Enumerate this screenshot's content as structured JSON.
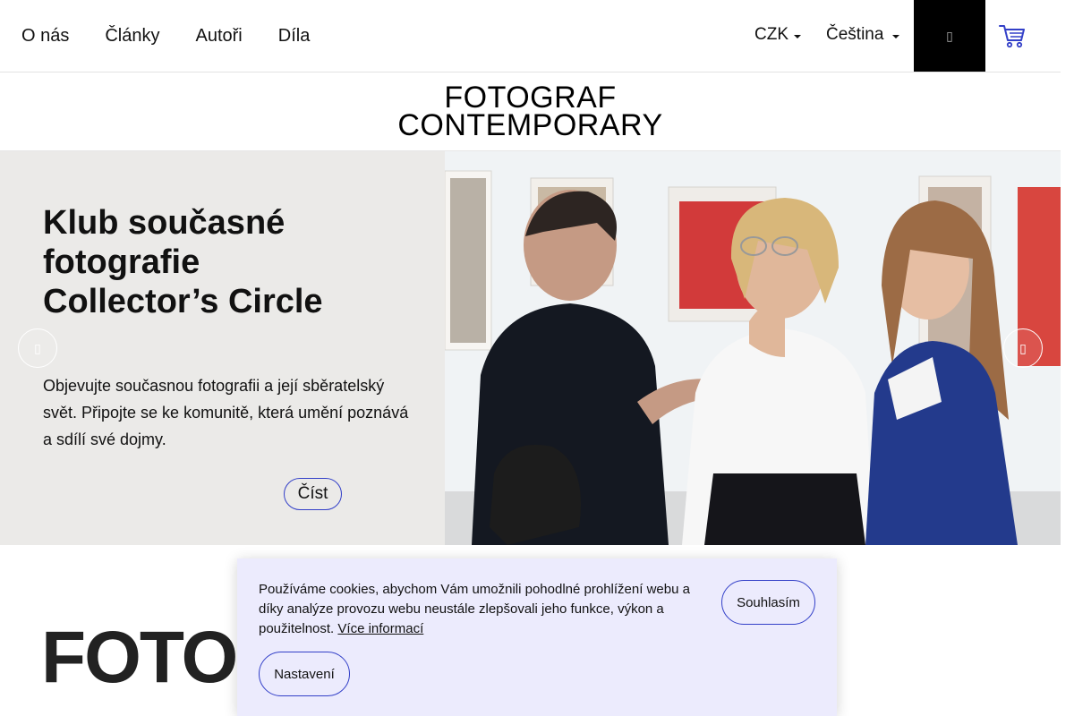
{
  "nav": {
    "links": [
      "O nás",
      "Články",
      "Autoři",
      "Díla"
    ],
    "currency": "CZK",
    "language": "Čeština",
    "search_icon": "search-icon",
    "cart_icon": "cart-icon"
  },
  "logo": {
    "line1": "FOTOGRAF",
    "line2": "CONTEMPORARY"
  },
  "hero": {
    "title_line1": "Klub současné",
    "title_line2": "fotografie",
    "title_line3": "Collector’s Circle",
    "text": "Objevujte současnou fotografii a její sběratelský svět. Připojte se ke komunitě, která umění poznává a sdílí své dojmy.",
    "read_label": "Číst",
    "prev_icon": "chevron-left-icon",
    "next_icon": "chevron-right-icon"
  },
  "section": {
    "heading": "FOTOG"
  },
  "cookie": {
    "text": "Používáme cookies, abychom Vám umožnili pohodlné prohlížení webu a díky analýze provozu webu neustále zlepšovali jeho funkce, výkon a použitelnost.",
    "more_link": "Více informací",
    "agree_label": "Souhlasím",
    "settings_label": "Nastavení"
  },
  "colors": {
    "accent": "#3340c8",
    "cookie_bg": "#ecebfd",
    "hero_bg": "#ebeae8"
  }
}
